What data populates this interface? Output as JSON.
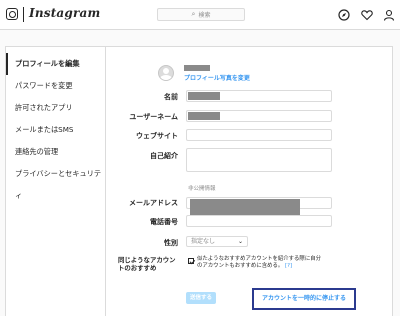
{
  "header": {
    "logo_text": "Instagram",
    "search_placeholder": "検索",
    "icons": [
      "instagram-camera-icon",
      "compass-icon",
      "heart-icon",
      "person-icon"
    ]
  },
  "sidebar": {
    "items": [
      {
        "label": "プロフィールを編集",
        "active": true
      },
      {
        "label": "パスワードを変更",
        "active": false
      },
      {
        "label": "許可されたアプリ",
        "active": false
      },
      {
        "label": "メールまたはSMS",
        "active": false
      },
      {
        "label": "連絡先の管理",
        "active": false
      },
      {
        "label": "プライバシーとセキュリティ",
        "active": false
      }
    ]
  },
  "profile": {
    "change_photo_label": "プロフィール写真を変更"
  },
  "form": {
    "name_label": "名前",
    "username_label": "ユーザーネーム",
    "website_label": "ウェブサイト",
    "bio_label": "自己紹介",
    "private_info_label": "非公開情報",
    "email_label": "メールアドレス",
    "phone_label": "電話番号",
    "gender_label": "性別",
    "gender_value": "指定なし",
    "similar_accounts_label": "同じようなアカウントのおすすめ",
    "similar_accounts_text": "似たようなおすすめアカウントを紹介する際に自分のアカウントもおすすめに含める。",
    "help_link": "[?]",
    "submit_label": "送信する",
    "disable_label": "アカウントを一時的に停止する"
  },
  "colors": {
    "accent": "#3897f0",
    "submit_bg": "#b2dffc",
    "highlight_border": "#2b3a8f"
  }
}
